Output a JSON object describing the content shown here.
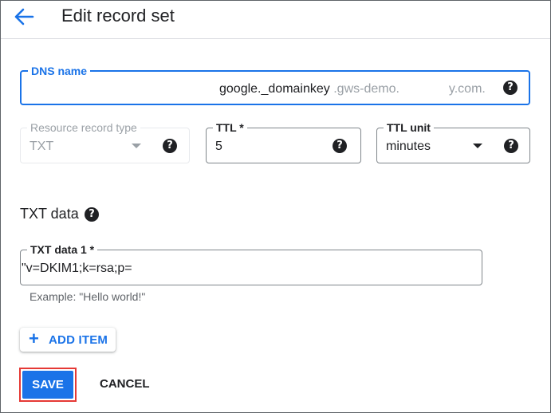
{
  "header": {
    "back_icon": "arrow-left-icon",
    "title": "Edit record set"
  },
  "form": {
    "dns_name": {
      "label": "DNS name",
      "prefix": "google._domainkey",
      "suffix_start": ".gws-demo.",
      "suffix_end": "y.com.",
      "help_icon": "help-icon"
    },
    "resource_record_type": {
      "label": "Resource record type",
      "value": "TXT",
      "disabled": true
    },
    "ttl": {
      "label": "TTL *",
      "value": "5"
    },
    "ttl_unit": {
      "label": "TTL unit",
      "value": "minutes"
    },
    "txt_section": {
      "title": "TXT data"
    },
    "txt_data_1": {
      "label": "TXT data 1 *",
      "value": "\"v=DKIM1;k=rsa;p=",
      "hint": "Example: \"Hello world!\""
    },
    "add_item": {
      "icon": "plus-icon",
      "label": "ADD ITEM"
    }
  },
  "actions": {
    "save_label": "SAVE",
    "cancel_label": "CANCEL"
  },
  "colors": {
    "accent": "#1a73e8",
    "highlight_outline": "#e53935",
    "help_icon_bg": "#202124"
  }
}
